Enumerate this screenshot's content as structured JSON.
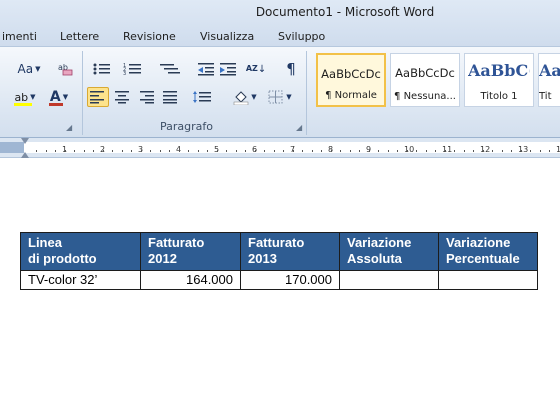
{
  "window": {
    "title": "Documento1  -  Microsoft Word"
  },
  "tabs": [
    "imenti",
    "Lettere",
    "Revisione",
    "Visualizza",
    "Sviluppo"
  ],
  "ribbon": {
    "paragraph_group_label": "Paragrafo",
    "font_size_button": "Aa",
    "pilcrow": "¶",
    "highlight_letter": "ab",
    "font_color_letter": "A",
    "sort_letters": "AZ"
  },
  "styles": [
    {
      "sample": "AaBbCcDc",
      "label": "¶ Normale",
      "active": true
    },
    {
      "sample": "AaBbCcDc",
      "label": "¶ Nessuna...",
      "active": false
    },
    {
      "sample": "AaBbC(",
      "label": "Titolo 1",
      "active": false
    },
    {
      "sample": "AaB",
      "label": "Tit",
      "active": false
    }
  ],
  "ruler": {
    "numbers": [
      "1",
      "2",
      "3",
      "4",
      "5",
      "6",
      "7",
      "8",
      "9",
      "10",
      "11",
      "12",
      "13",
      "14"
    ]
  },
  "table": {
    "headers": [
      {
        "line1": "Linea",
        "line2": "di prodotto"
      },
      {
        "line1": "Fatturato",
        "line2": "2012"
      },
      {
        "line1": "Fatturato",
        "line2": "2013"
      },
      {
        "line1": "Variazione",
        "line2": "Assoluta"
      },
      {
        "line1": "Variazione",
        "line2": "Percentuale"
      }
    ],
    "rows": [
      [
        "TV-color 32’",
        "164.000",
        "170.000",
        "",
        ""
      ]
    ]
  },
  "colors": {
    "header_fill": "#2e5c92",
    "ribbon_bg": "#dce6f2",
    "active_style_border": "#f2c148"
  }
}
